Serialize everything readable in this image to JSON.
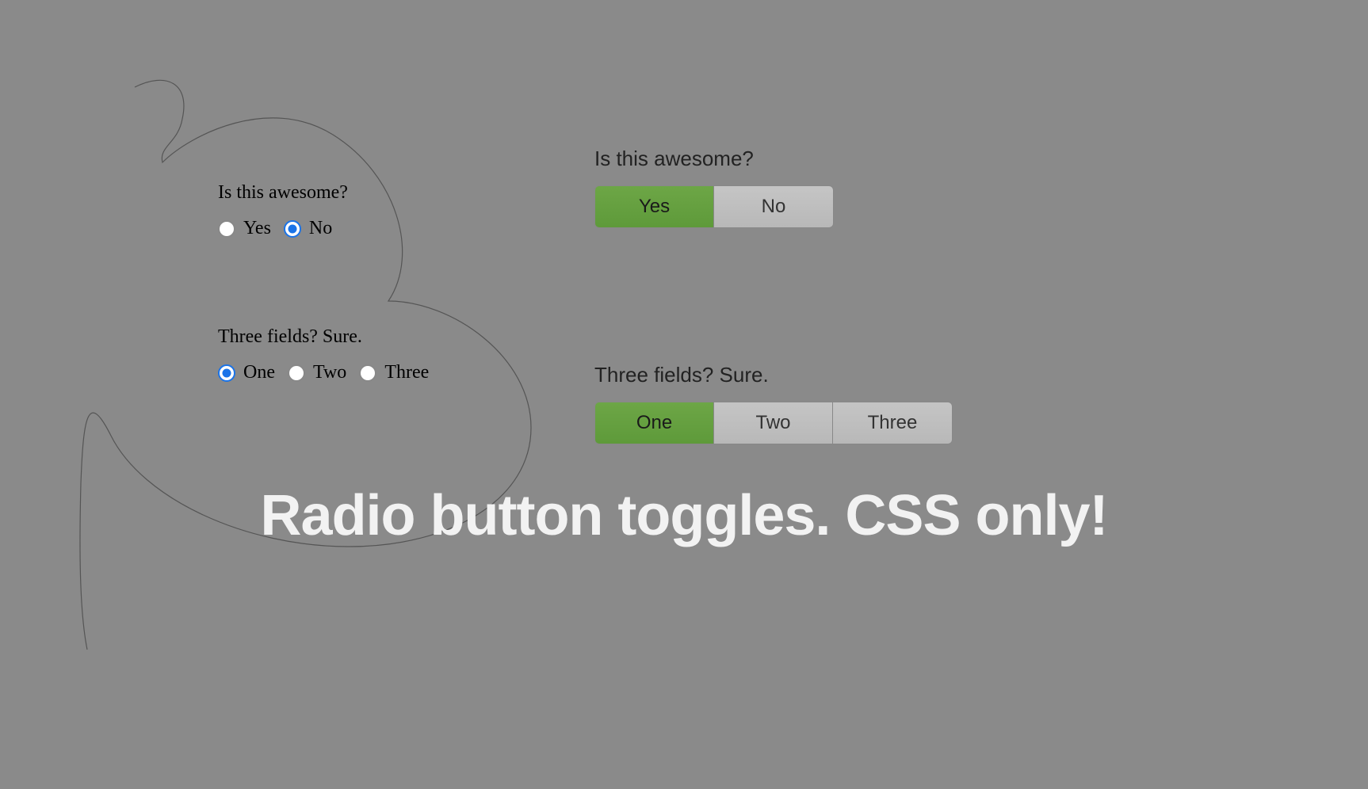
{
  "hero": {
    "title": "Radio button toggles. CSS only!"
  },
  "colors": {
    "background": "#8a8a8a",
    "accent_blue": "#1a73e8",
    "toggle_active": "#5e9a3a",
    "toggle_inactive": "#bfbfbf",
    "hero_text": "#f2f2f2"
  },
  "group1": {
    "question": "Is this awesome?",
    "options": [
      {
        "label": "Yes",
        "checked_native": false,
        "checked_toggle": true
      },
      {
        "label": "No",
        "checked_native": true,
        "checked_toggle": false
      }
    ]
  },
  "group2": {
    "question": "Three fields? Sure.",
    "options": [
      {
        "label": "One",
        "checked_native": true,
        "checked_toggle": true
      },
      {
        "label": "Two",
        "checked_native": false,
        "checked_toggle": false
      },
      {
        "label": "Three",
        "checked_native": false,
        "checked_toggle": false
      }
    ]
  }
}
